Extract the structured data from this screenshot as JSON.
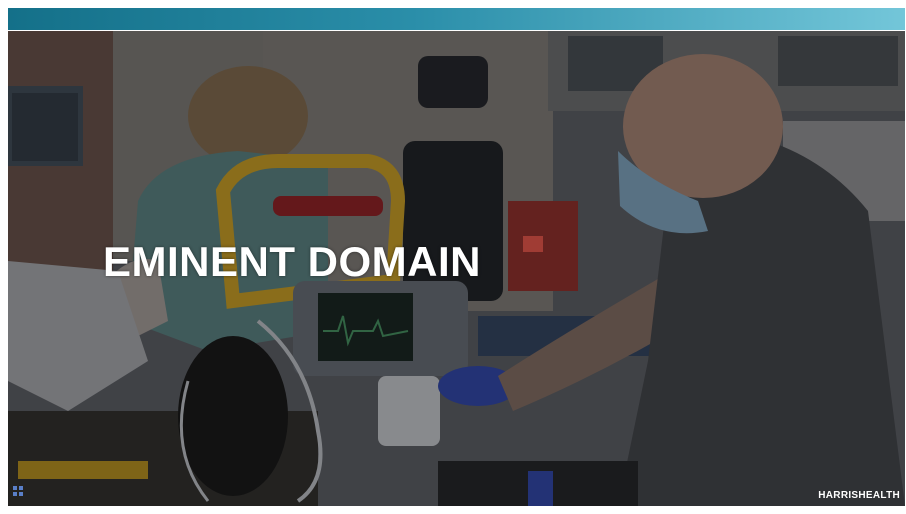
{
  "slide": {
    "title": "EMINENT DOMAIN",
    "logo_text": "HARRISHEALTH"
  },
  "colors": {
    "top_bar_start": "#147089",
    "top_bar_end": "#73c6d9",
    "title": "#ffffff"
  },
  "icons": {
    "slide_nav": "grid-icon"
  }
}
